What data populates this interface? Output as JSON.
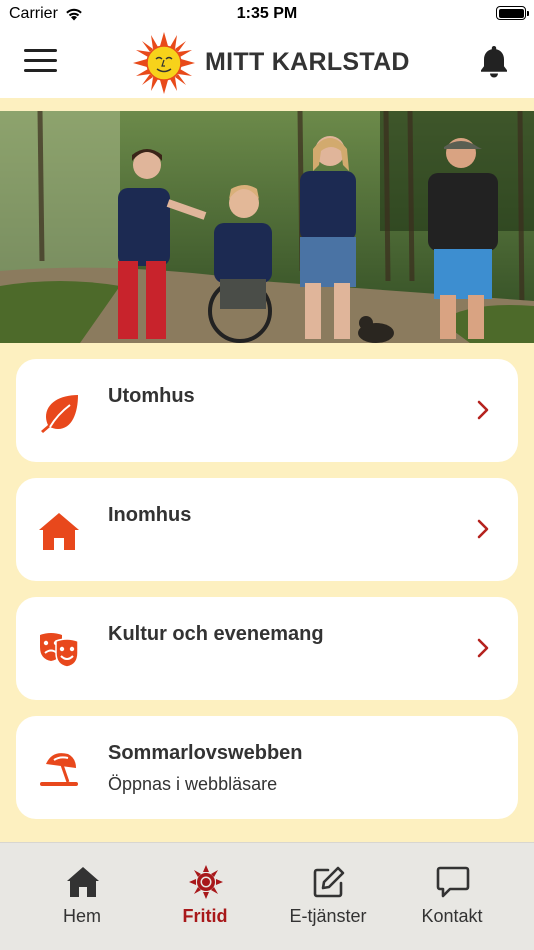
{
  "status_bar": {
    "carrier": "Carrier",
    "time": "1:35 PM"
  },
  "header": {
    "title": "MITT KARLSTAD",
    "menu_icon": "hamburger-icon",
    "notification_icon": "bell-icon",
    "logo": "sun-logo"
  },
  "hero": {
    "alt": "Fyra personer promenerar på en skogsväg"
  },
  "cards": [
    {
      "title": "Utomhus",
      "subtitle": "",
      "icon": "leaf-icon",
      "has_chevron": true
    },
    {
      "title": "Inomhus",
      "subtitle": "",
      "icon": "house-icon",
      "has_chevron": true
    },
    {
      "title": "Kultur och evenemang",
      "subtitle": "",
      "icon": "theater-masks-icon",
      "has_chevron": true
    },
    {
      "title": "Sommarlovswebben",
      "subtitle": "Öppnas i webbläsare",
      "icon": "beach-umbrella-icon",
      "has_chevron": false
    }
  ],
  "tabs": [
    {
      "label": "Hem",
      "icon": "home-icon",
      "active": false
    },
    {
      "label": "Fritid",
      "icon": "sun-icon",
      "active": true
    },
    {
      "label": "E-tjänster",
      "icon": "edit-icon",
      "active": false
    },
    {
      "label": "Kontakt",
      "icon": "chat-icon",
      "active": false
    }
  ],
  "colors": {
    "accent": "#e8481c",
    "active_tab": "#a8181a",
    "background": "#fdf0c0",
    "chevron": "#b5221e"
  }
}
